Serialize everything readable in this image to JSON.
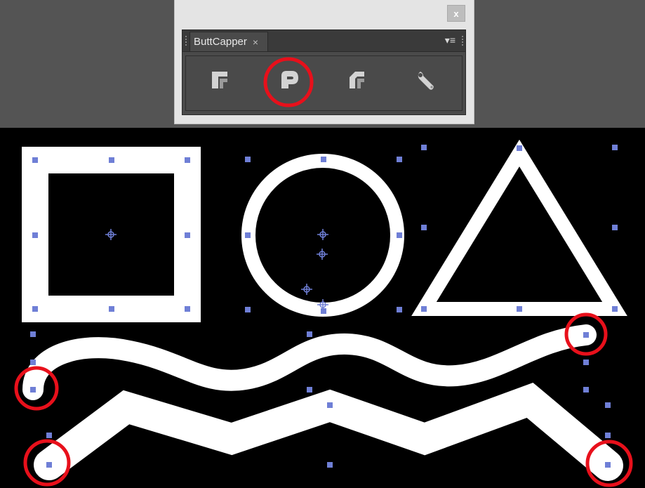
{
  "panel": {
    "title": "ButtCapper",
    "tab_close_glyph": "×",
    "close_button_glyph": "x",
    "menu_glyph": "▾≡",
    "tools": [
      {
        "name": "butt-cap-icon",
        "selected": false
      },
      {
        "name": "round-cap-icon",
        "selected": true
      },
      {
        "name": "projecting-cap-icon",
        "selected": false
      },
      {
        "name": "wrench-icon",
        "selected": false
      }
    ]
  },
  "canvas": {
    "background": "#000000",
    "stroke_color": "#ffffff",
    "anchor_color": "#6f7fd6",
    "highlight_color": "#e8101b",
    "shapes": [
      "square",
      "circle",
      "triangle",
      "wave-path",
      "zigzag-path"
    ],
    "cap_style": "round"
  }
}
